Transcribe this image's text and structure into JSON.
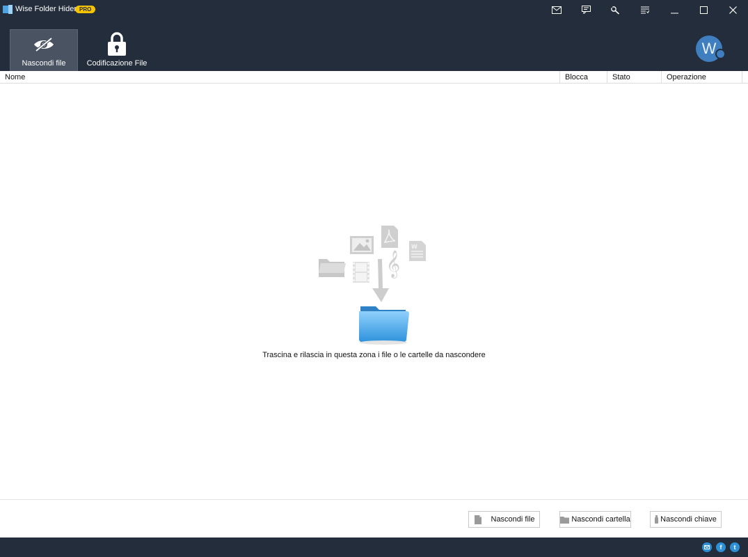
{
  "window": {
    "title": "Wise Folder Hider",
    "badge": "PRO"
  },
  "titlebar_icons": [
    "mail-icon",
    "feedback-icon",
    "tools-icon",
    "menu-icon",
    "minimize-icon",
    "maximize-icon",
    "close-icon"
  ],
  "toolbar": {
    "tabs": [
      {
        "label": "Nascondi file",
        "icon": "hidden-eye-icon",
        "active": true
      },
      {
        "label": "Codificazione File",
        "icon": "padlock-icon",
        "active": false
      }
    ],
    "avatar_letter": "W"
  },
  "table": {
    "columns": [
      "Nome",
      "Blocca",
      "Stato",
      "Operazione"
    ]
  },
  "dropzone": {
    "hint": "Trascina e rilascia in questa zona i file o le cartelle da nascondere"
  },
  "actions": {
    "hide_file": "Nascondi file",
    "hide_folder": "Nascondi cartella",
    "hide_usb": "Nascondi chiave"
  },
  "social": {
    "facebook": "f",
    "twitter": "t"
  },
  "colors": {
    "chrome": "#232d3b",
    "active_tab": "#4a5362",
    "pro_badge": "#f6c400",
    "avatar": "#3f7fbf",
    "social": "#2d8fd6"
  }
}
